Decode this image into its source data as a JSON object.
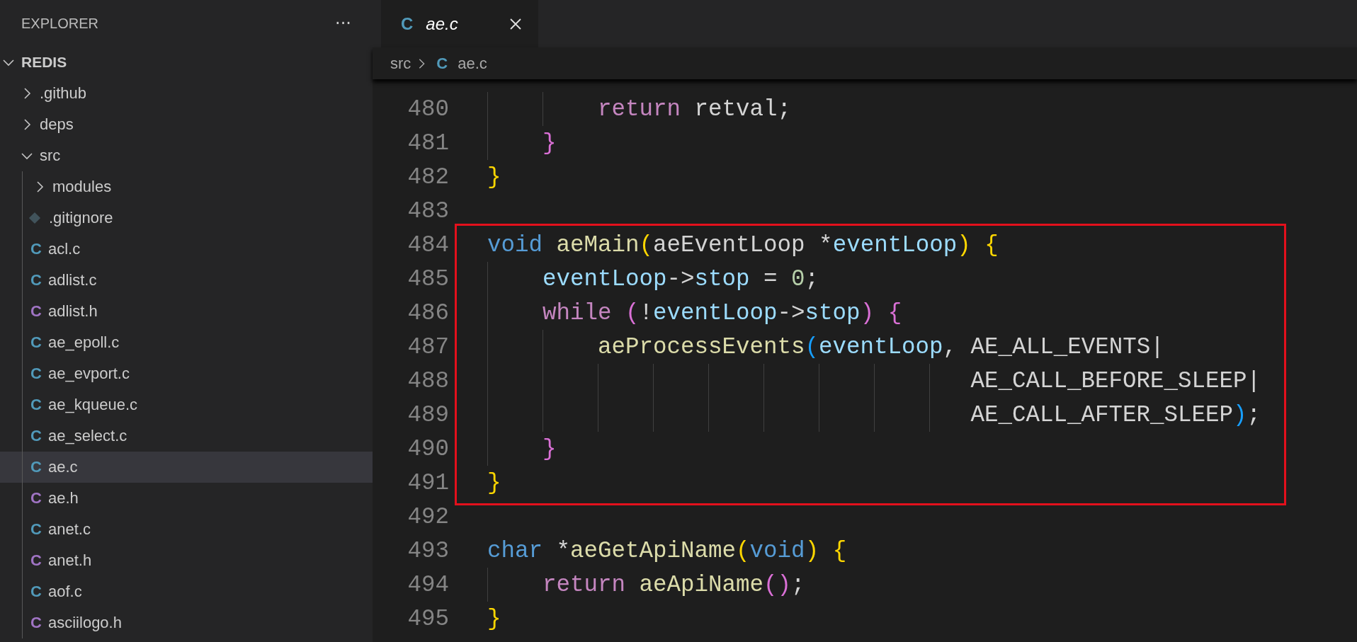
{
  "explorer": {
    "title": "EXPLORER",
    "more": "···",
    "tree": [
      {
        "label": "REDIS",
        "kind": "root",
        "expanded": true,
        "selected": false,
        "children": [
          {
            "label": ".github",
            "kind": "folder",
            "expanded": false,
            "selected": false
          },
          {
            "label": "deps",
            "kind": "folder",
            "expanded": false,
            "selected": false
          },
          {
            "label": "src",
            "kind": "folder",
            "expanded": true,
            "selected": false,
            "children": [
              {
                "label": "modules",
                "kind": "folder",
                "expanded": false,
                "selected": false
              },
              {
                "label": ".gitignore",
                "kind": "git",
                "selected": false
              },
              {
                "label": "acl.c",
                "kind": "c_source",
                "badge": "C",
                "selected": false
              },
              {
                "label": "adlist.c",
                "kind": "c_source",
                "badge": "C",
                "selected": false
              },
              {
                "label": "adlist.h",
                "kind": "c_header",
                "badge": "C",
                "selected": false
              },
              {
                "label": "ae_epoll.c",
                "kind": "c_source",
                "badge": "C",
                "selected": false
              },
              {
                "label": "ae_evport.c",
                "kind": "c_source",
                "badge": "C",
                "selected": false
              },
              {
                "label": "ae_kqueue.c",
                "kind": "c_source",
                "badge": "C",
                "selected": false
              },
              {
                "label": "ae_select.c",
                "kind": "c_source",
                "badge": "C",
                "selected": false
              },
              {
                "label": "ae.c",
                "kind": "c_source",
                "badge": "C",
                "selected": true
              },
              {
                "label": "ae.h",
                "kind": "c_header",
                "badge": "C",
                "selected": false
              },
              {
                "label": "anet.c",
                "kind": "c_source",
                "badge": "C",
                "selected": false
              },
              {
                "label": "anet.h",
                "kind": "c_header",
                "badge": "C",
                "selected": false
              },
              {
                "label": "aof.c",
                "kind": "c_source",
                "badge": "C",
                "selected": false
              },
              {
                "label": "asciilogo.h",
                "kind": "c_header",
                "badge": "C",
                "selected": false
              }
            ]
          }
        ]
      }
    ]
  },
  "tab": {
    "badge": "C",
    "kind": "c_source",
    "label": "ae.c",
    "preview": true
  },
  "breadcrumb": [
    {
      "label": "src",
      "kind": "folder"
    },
    {
      "label": "ae.c",
      "kind": "c_source",
      "badge": "C"
    }
  ],
  "code_blocks": [
    {
      "highlighted": false,
      "lines": [
        {
          "number": "480",
          "tokens": [
            {
              "kind": "ctrl",
              "text": "        return "
            },
            {
              "kind": "plain",
              "text": "retval;"
            }
          ]
        },
        {
          "number": "481",
          "tokens": [
            {
              "kind": "b2",
              "text": "    }"
            }
          ]
        },
        {
          "number": "482",
          "tokens": [
            {
              "kind": "b1",
              "text": "}"
            }
          ]
        },
        {
          "number": "483"
        }
      ]
    },
    {
      "highlighted": true,
      "lines": [
        {
          "number": "484",
          "tokens": [
            {
              "kind": "kw",
              "text": "void "
            },
            {
              "kind": "fn",
              "text": "aeMain"
            },
            {
              "kind": "b1",
              "text": "("
            },
            {
              "kind": "plain",
              "text": "aeEventLoop *"
            },
            {
              "kind": "var",
              "text": "eventLoop"
            },
            {
              "kind": "b1",
              "text": ") {"
            }
          ]
        },
        {
          "number": "485",
          "tokens": [
            {
              "kind": "var",
              "text": "    eventLoop"
            },
            {
              "kind": "plain",
              "text": "->"
            },
            {
              "kind": "var",
              "text": "stop"
            },
            {
              "kind": "plain",
              "text": " = "
            },
            {
              "kind": "num",
              "text": "0"
            },
            {
              "kind": "plain",
              "text": ";"
            }
          ]
        },
        {
          "number": "486",
          "tokens": [
            {
              "kind": "ctrl",
              "text": "    while "
            },
            {
              "kind": "b2",
              "text": "("
            },
            {
              "kind": "plain",
              "text": "!"
            },
            {
              "kind": "var",
              "text": "eventLoop"
            },
            {
              "kind": "plain",
              "text": "->"
            },
            {
              "kind": "var",
              "text": "stop"
            },
            {
              "kind": "b2",
              "text": ") {"
            }
          ]
        },
        {
          "number": "487",
          "tokens": [
            {
              "kind": "fn",
              "text": "        aeProcessEvents"
            },
            {
              "kind": "b3",
              "text": "("
            },
            {
              "kind": "var",
              "text": "eventLoop"
            },
            {
              "kind": "plain",
              "text": ", AE_ALL_EVENTS|"
            }
          ]
        },
        {
          "number": "488",
          "tokens": [
            {
              "kind": "plain",
              "text": "                                   AE_CALL_BEFORE_SLEEP|"
            }
          ]
        },
        {
          "number": "489",
          "tokens": [
            {
              "kind": "plain",
              "text": "                                   AE_CALL_AFTER_SLEEP"
            },
            {
              "kind": "b3",
              "text": ")"
            },
            {
              "kind": "plain",
              "text": ";"
            }
          ]
        },
        {
          "number": "490",
          "tokens": [
            {
              "kind": "b2",
              "text": "    }"
            }
          ]
        },
        {
          "number": "491",
          "tokens": [
            {
              "kind": "b1",
              "text": "}"
            }
          ]
        }
      ]
    },
    {
      "highlighted": false,
      "lines": [
        {
          "number": "492"
        },
        {
          "number": "493",
          "tokens": [
            {
              "kind": "kw",
              "text": "char "
            },
            {
              "kind": "plain",
              "text": "*"
            },
            {
              "kind": "fn",
              "text": "aeGetApiName"
            },
            {
              "kind": "b1",
              "text": "("
            },
            {
              "kind": "kw",
              "text": "void"
            },
            {
              "kind": "b1",
              "text": ") {"
            }
          ]
        },
        {
          "number": "494",
          "tokens": [
            {
              "kind": "ctrl",
              "text": "    return "
            },
            {
              "kind": "fn",
              "text": "aeApiName"
            },
            {
              "kind": "b2",
              "text": "()"
            },
            {
              "kind": "plain",
              "text": ";"
            }
          ]
        },
        {
          "number": "495",
          "tokens": [
            {
              "kind": "b1",
              "text": "}"
            }
          ]
        }
      ]
    }
  ]
}
